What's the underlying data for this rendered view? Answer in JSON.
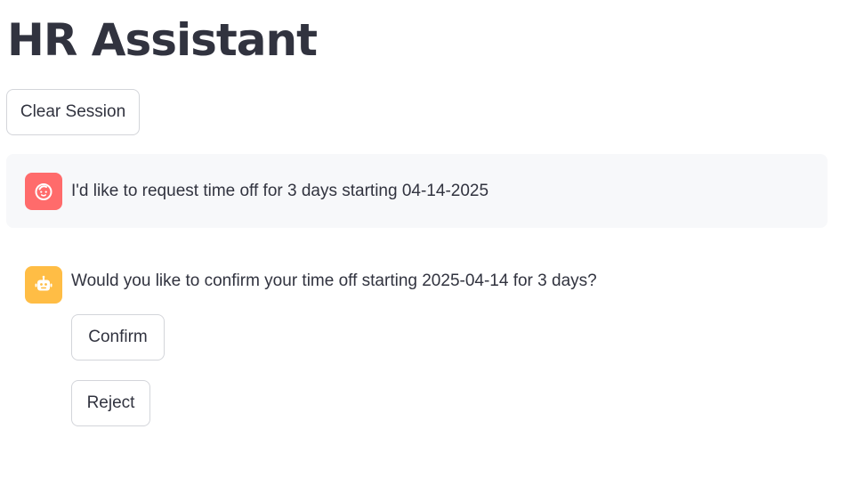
{
  "page": {
    "title": "HR Assistant"
  },
  "toolbar": {
    "clear_label": "Clear Session"
  },
  "chat": {
    "messages": [
      {
        "role": "user",
        "avatar_icon": "user-face-icon",
        "avatar_color": "#ff6b6b",
        "text": "I'd like to request time off for 3 days starting 04-14-2025"
      },
      {
        "role": "assistant",
        "avatar_icon": "robot-icon",
        "avatar_color": "#ffbd45",
        "text": "Would you like to confirm your time off starting 2025-04-14 for 3 days?",
        "actions": [
          {
            "label": "Confirm"
          },
          {
            "label": "Reject"
          }
        ]
      }
    ]
  }
}
